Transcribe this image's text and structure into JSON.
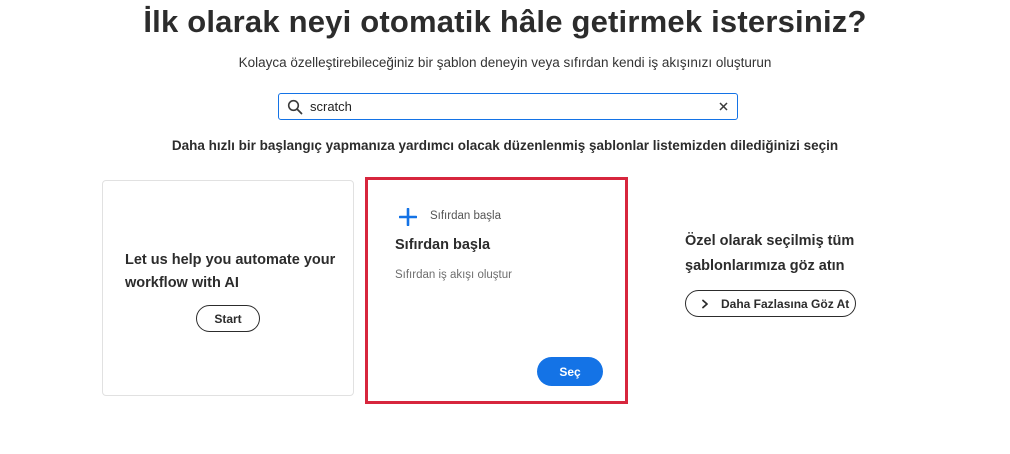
{
  "header": {
    "title": "İlk olarak neyi otomatik hâle getirmek istersiniz?",
    "subtitle": "Kolayca özelleştirebileceğiniz bir şablon deneyin veya sıfırdan kendi iş akışınızı oluşturun"
  },
  "search": {
    "value": "scratch",
    "icon": "search-icon",
    "clear_icon": "close-icon"
  },
  "instruction": "Daha hızlı bir başlangıç yapmanıza yardımcı olacak düzenlenmiş şablonlar listemizden dilediğinizi seçin",
  "cards": {
    "ai": {
      "text": "Let us help you automate your workflow with AI",
      "button": "Start"
    },
    "scratch": {
      "icon": "plus-icon",
      "small_label": "Sıfırdan başla",
      "title": "Sıfırdan başla",
      "description": "Sıfırdan iş akışı oluştur",
      "button": "Seç",
      "selected": true
    }
  },
  "curated": {
    "text": "Özel olarak seçilmiş tüm şablonlarımıza göz atın",
    "button": "Daha Fazlasına Göz At",
    "icon": "chevron-right-icon"
  },
  "colors": {
    "accent": "#1473e6",
    "highlight": "#d7263d",
    "text": "#2c2c2c"
  }
}
